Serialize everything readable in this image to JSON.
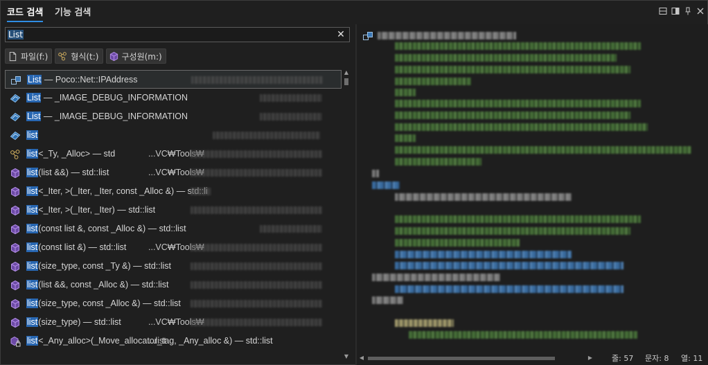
{
  "tabs": [
    {
      "label": "코드 검색",
      "active": true
    },
    {
      "label": "기능 검색",
      "active": false
    }
  ],
  "window_controls": [
    "window-layout",
    "dock-window",
    "pin",
    "close"
  ],
  "search": {
    "value": "List"
  },
  "filters": [
    {
      "label": "파일(f:)",
      "icon": "file-icon"
    },
    {
      "label": "형식(t:)",
      "icon": "type-icon"
    },
    {
      "label": "구성원(m:)",
      "icon": "member-icon"
    }
  ],
  "results": [
    {
      "icon": "class-icon",
      "match": "List",
      "rest": " — Poco::Net::IPAddress",
      "path": "",
      "selected": true
    },
    {
      "icon": "struct-icon",
      "match": "List",
      "rest": " — _IMAGE_DEBUG_INFORMATION",
      "path": ""
    },
    {
      "icon": "struct-icon",
      "match": "List",
      "rest": " — _IMAGE_DEBUG_INFORMATION",
      "path": ""
    },
    {
      "icon": "struct-icon",
      "match": "list",
      "rest": "",
      "path": ""
    },
    {
      "icon": "template-icon",
      "match": "list",
      "rest": "<_Ty, _Alloc> — std",
      "path": "...VC₩Tools₩"
    },
    {
      "icon": "method-icon",
      "match": "list",
      "rest": "(list &&) — std::list",
      "path": "...VC₩Tools₩"
    },
    {
      "icon": "method-icon",
      "match": "list",
      "rest": "<_Iter, >(_Iter, _Iter, const _Alloc &) — std::li",
      "path": ""
    },
    {
      "icon": "method-icon",
      "match": "list",
      "rest": "<_Iter, >(_Iter, _Iter) — std::list",
      "path": ""
    },
    {
      "icon": "method-icon",
      "match": "list",
      "rest": "(const list &, const _Alloc &) — std::list",
      "path": ""
    },
    {
      "icon": "method-icon",
      "match": "list",
      "rest": "(const list &) — std::list",
      "path": "...VC₩Tools₩"
    },
    {
      "icon": "method-icon",
      "match": "list",
      "rest": "(size_type, const _Ty &) — std::list",
      "path": ""
    },
    {
      "icon": "method-icon",
      "match": "list",
      "rest": "(list &&, const _Alloc &) — std::list",
      "path": ""
    },
    {
      "icon": "method-icon",
      "match": "list",
      "rest": "(size_type, const _Alloc &) — std::list",
      "path": ""
    },
    {
      "icon": "method-icon",
      "match": "list",
      "rest": "(size_type) — std::list",
      "path": "...VC₩Tools₩"
    },
    {
      "icon": "method-locked-icon",
      "match": "list",
      "rest": "<_Any_alloc>(_Move_allocator_tag, _Any_alloc &) — std::list",
      "path": "...list"
    }
  ],
  "status": {
    "line": "줄: 57",
    "char": "문자: 8",
    "col": "열: 11"
  },
  "colors": {
    "accent": "#2f8de4",
    "highlight": "#2867b2",
    "background": "#1f1f1f"
  }
}
